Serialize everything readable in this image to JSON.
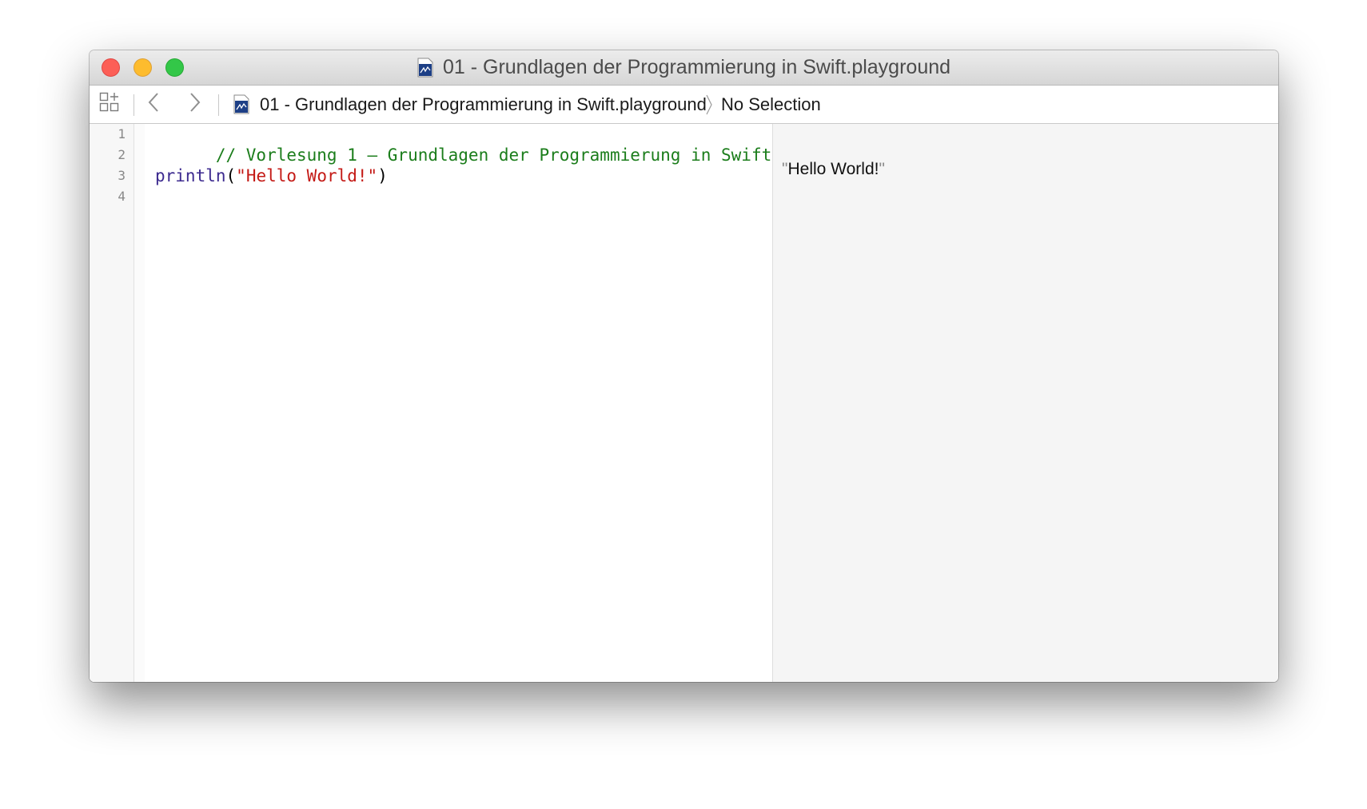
{
  "window": {
    "title": "01 - Grundlagen der Programmierung in Swift.playground"
  },
  "toolbar": {
    "grid_icon": "related-items-grid-icon",
    "back_icon": "chevron-left-icon",
    "forward_icon": "chevron-right-icon",
    "breadcrumb": {
      "file": "01 - Grundlagen der Programmierung in Swift.playground",
      "separator_icon": "breadcrumb-chevron-icon",
      "selection": "No Selection"
    }
  },
  "editor": {
    "line_numbers": [
      "1",
      "2",
      "3",
      "4"
    ],
    "lines": {
      "line1": {
        "comment": "// Vorlesung 1 – Grundlagen der Programmierung in Swift"
      },
      "line3": {
        "func": "println",
        "open": "(",
        "string": "\"Hello World!\"",
        "close": ")"
      }
    }
  },
  "results": {
    "open_quote": "\"",
    "value": "Hello World!",
    "close_quote": "\""
  },
  "colors": {
    "comment": "#1b7d1b",
    "function": "#3c2a8f",
    "string": "#c41a16",
    "close_button": "#fc5f57",
    "minimize_button": "#fdbc2e",
    "zoom_button": "#33c748"
  }
}
